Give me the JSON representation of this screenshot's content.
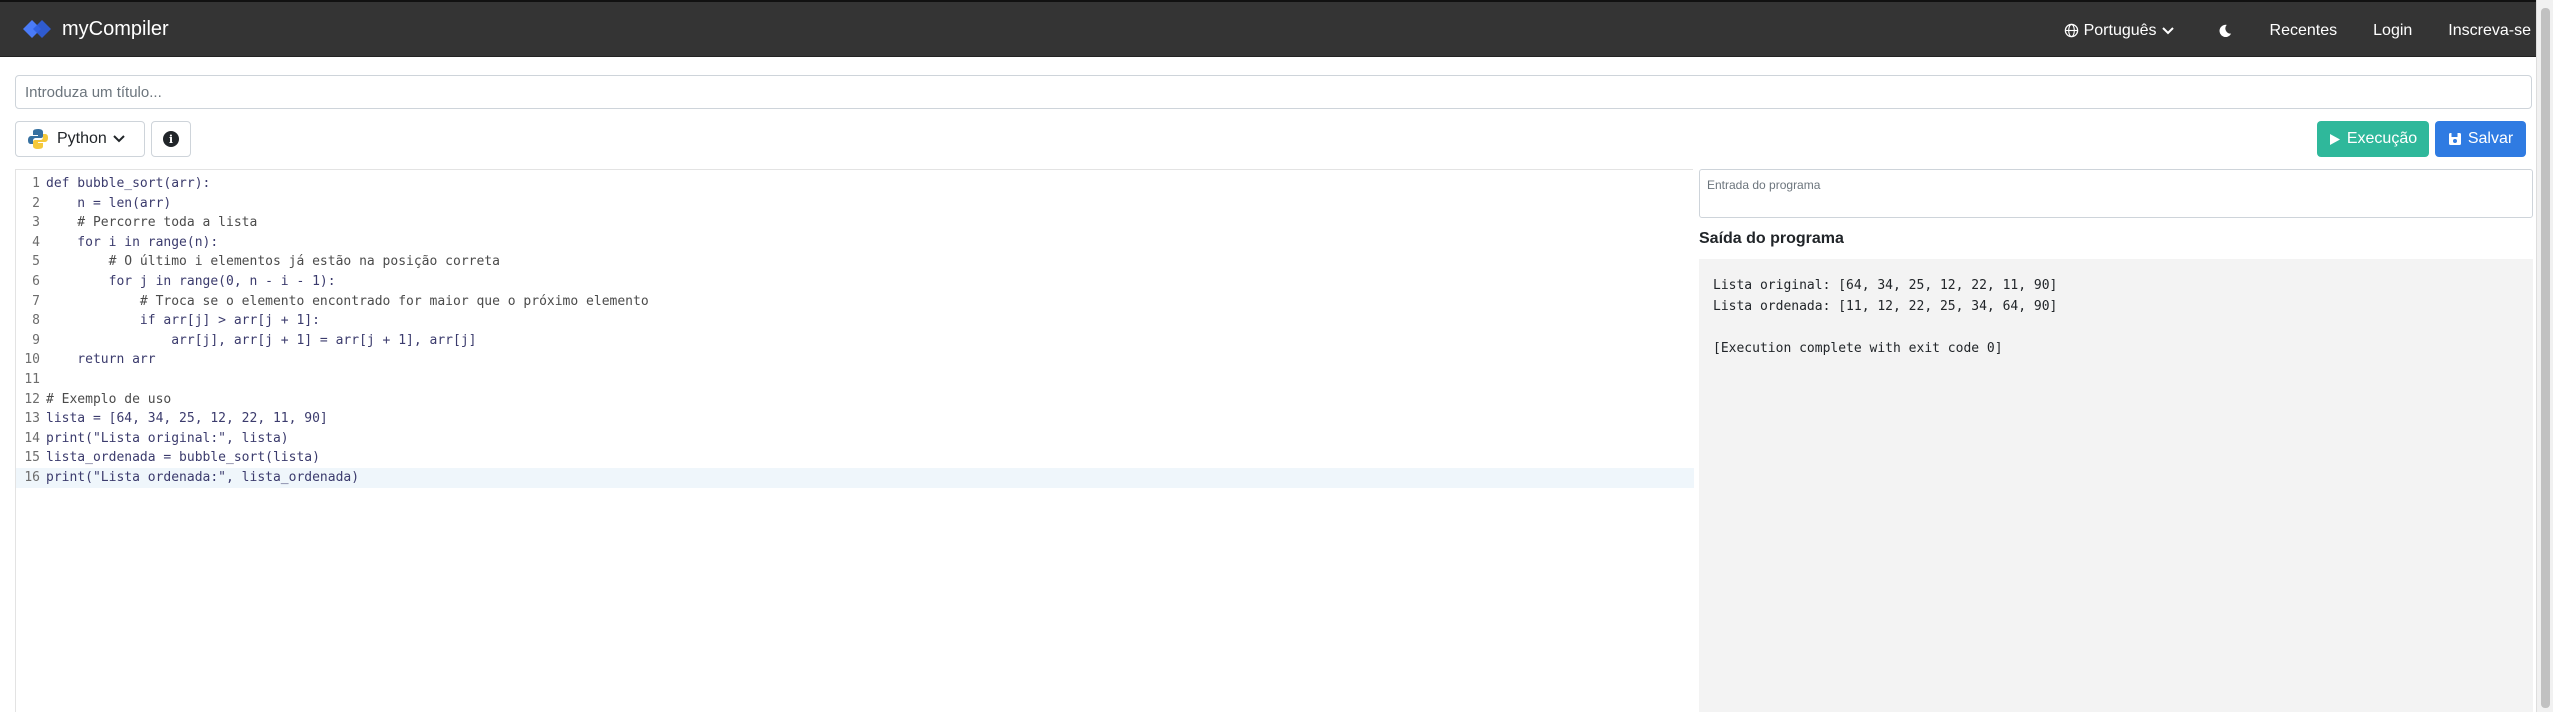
{
  "navbar": {
    "brand": "myCompiler",
    "language": "Português",
    "links": [
      "Recentes",
      "Login",
      "Inscreva-se"
    ]
  },
  "title_input": {
    "placeholder": "Introduza um título..."
  },
  "toolbar": {
    "language": "Python",
    "run_label": "Execução",
    "save_label": "Salvar"
  },
  "editor": {
    "active_line": 16,
    "lines": [
      "def bubble_sort(arr):",
      "    n = len(arr)",
      "    # Percorre toda a lista",
      "    for i in range(n):",
      "        # O último i elementos já estão na posição correta",
      "        for j in range(0, n - i - 1):",
      "            # Troca se o elemento encontrado for maior que o próximo elemento",
      "            if arr[j] > arr[j + 1]:",
      "                arr[j], arr[j + 1] = arr[j + 1], arr[j]",
      "    return arr",
      "",
      "# Exemplo de uso",
      "lista = [64, 34, 25, 12, 22, 11, 90]",
      "print(\"Lista original:\", lista)",
      "lista_ordenada = bubble_sort(lista)",
      "print(\"Lista ordenada:\", lista_ordenada)"
    ]
  },
  "stdin": {
    "placeholder": "Entrada do programa"
  },
  "output": {
    "title": "Saída do programa",
    "lines": [
      "Lista original: [64, 34, 25, 12, 22, 11, 90]",
      "Lista ordenada: [11, 12, 22, 25, 34, 64, 90]",
      "",
      "[Execution complete with exit code 0]"
    ]
  },
  "colors": {
    "navbar": "#343434",
    "run": "#2fb89b",
    "save": "#2f7be2"
  }
}
